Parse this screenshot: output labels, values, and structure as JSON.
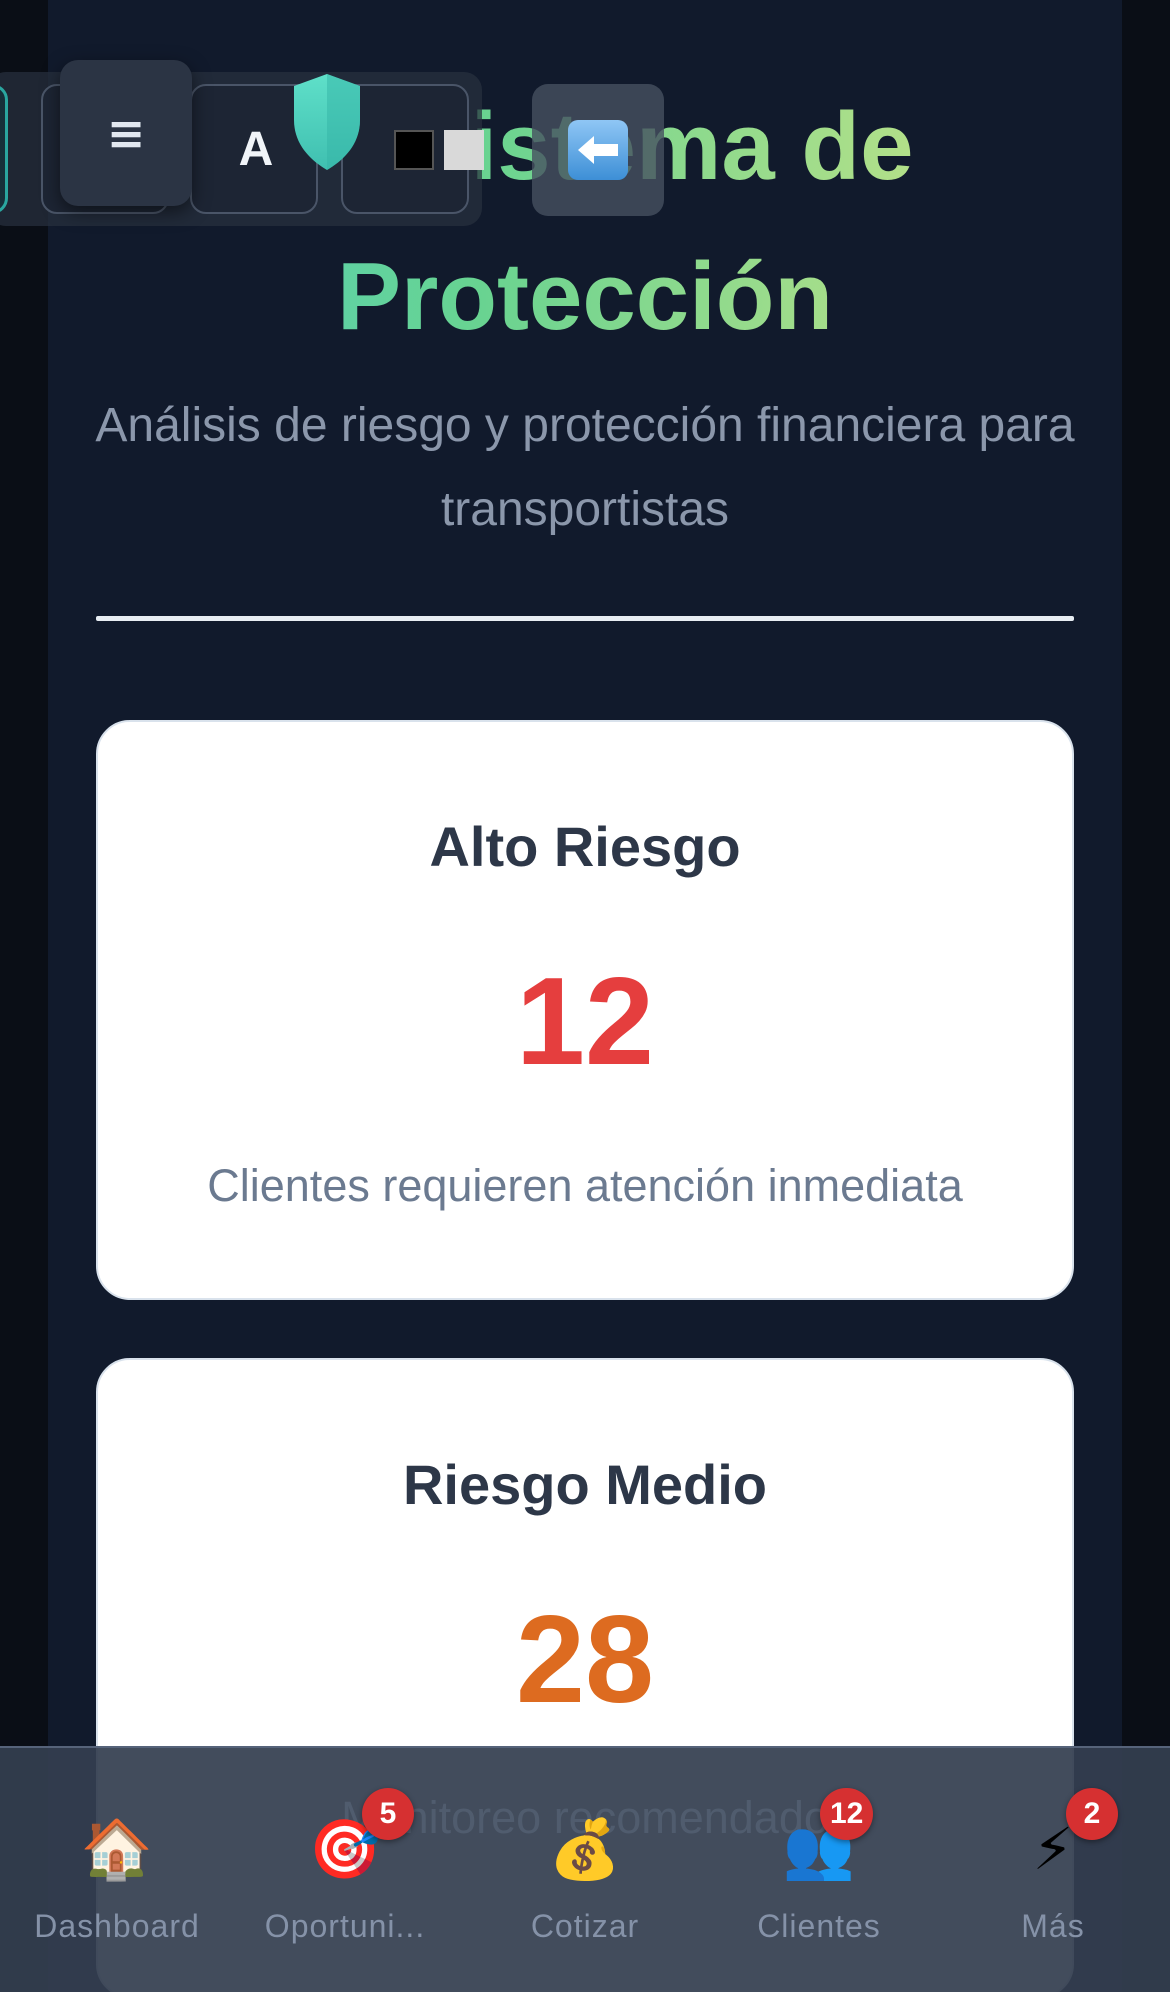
{
  "header": {
    "title_line1": "Sistema de",
    "title_line2": "Protección",
    "subtitle": "Análisis de riesgo y protección financiera para transportistas"
  },
  "toolbar": {
    "menu_icon": "≡",
    "font_size_label": "A",
    "contrast_icon": "contrast-toggle-icon",
    "back_icon": "back-arrow-icon",
    "shield_icon": "shield-icon"
  },
  "cards": [
    {
      "title": "Alto Riesgo",
      "value": "12",
      "value_color": "#e53e3e",
      "description": "Clientes requieren atención inmediata"
    },
    {
      "title": "Riesgo Medio",
      "value": "28",
      "value_color": "#dd6b20",
      "description": "Monitoreo recomendado"
    }
  ],
  "bottom_nav": [
    {
      "label": "Dashboard",
      "icon": "🏠",
      "icon_name": "house-icon",
      "badge": null
    },
    {
      "label": "Oportuni...",
      "icon": "🎯",
      "icon_name": "target-icon",
      "badge": "5"
    },
    {
      "label": "Cotizar",
      "icon": "💰",
      "icon_name": "money-bag-icon",
      "badge": null
    },
    {
      "label": "Clientes",
      "icon": "👥",
      "icon_name": "users-icon",
      "badge": "12"
    },
    {
      "label": "Más",
      "icon": "⚡",
      "icon_name": "lightning-icon",
      "badge": "2"
    }
  ],
  "colors": {
    "background": "#111a2c",
    "card": "#ffffff",
    "title_gradient_start": "#4fd1c5",
    "title_gradient_end": "#d6e685",
    "badge": "#d63031"
  }
}
